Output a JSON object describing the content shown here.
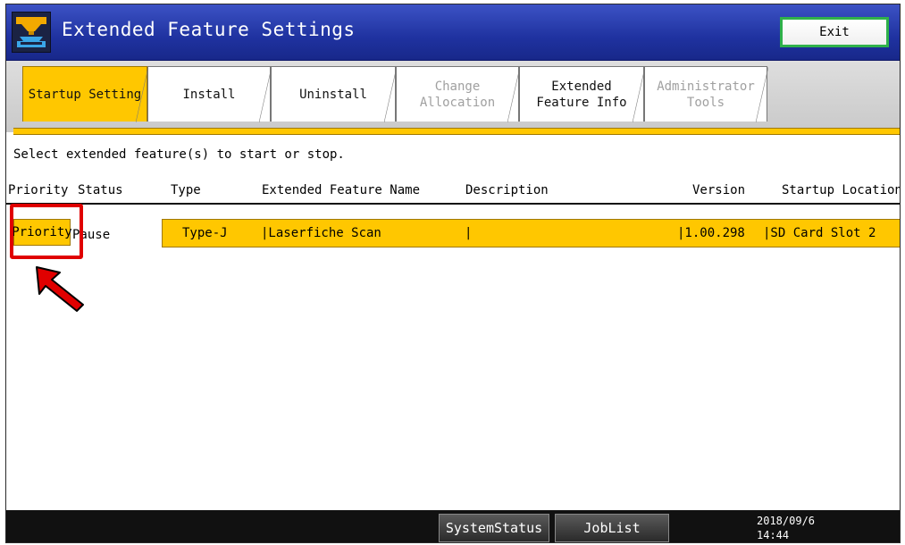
{
  "window": {
    "title": "Extended Feature Settings",
    "exit_label": "Exit"
  },
  "tabs": [
    {
      "label": "Startup Setting",
      "state": "active"
    },
    {
      "label": "Install",
      "state": "enabled"
    },
    {
      "label": "Uninstall",
      "state": "enabled"
    },
    {
      "label": "Change\nAllocation",
      "state": "disabled"
    },
    {
      "label": "Extended\nFeature Info",
      "state": "enabled"
    },
    {
      "label": "Administrator\nTools",
      "state": "disabled"
    }
  ],
  "instruction": "Select extended feature(s) to start or stop.",
  "columns": [
    "Priority",
    "Status",
    "Type",
    "Extended Feature Name",
    "Description",
    "Version",
    "Startup Location"
  ],
  "rows": [
    {
      "priority_label": "Priority",
      "status": "Pause",
      "type": "Type-J",
      "name": "|Laserfiche Scan",
      "description": "|",
      "version": "|1.00.298",
      "location": "|SD Card Slot 2"
    }
  ],
  "footer": {
    "system_status_label": "SystemStatus",
    "job_list_label": "JobList",
    "date": "2018/09/6",
    "time": "14:44"
  },
  "colors": {
    "title_bar": "#1f32a0",
    "selected": "#ffc700",
    "annotation": "#e00000",
    "exit_border": "#2fb14a"
  },
  "icons": {
    "app": "extended-feature-icon",
    "annotation": "red-arrow-icon"
  }
}
